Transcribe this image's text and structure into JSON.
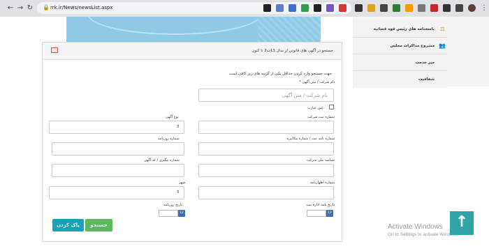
{
  "browser": {
    "url": "rrk.ir/News/newsList.aspx"
  },
  "right_menu": {
    "items": [
      {
        "label": "پاسخنامه های رئیس قوه قضائیه"
      },
      {
        "label": "مشروح مذاکرات مجلس"
      },
      {
        "label": "میز خدمت"
      },
      {
        "label": "شفافیت"
      }
    ]
  },
  "panel": {
    "title": "جستجو در آگهی های قانونی از سال 13ت2 تا کنون",
    "hint": "جهت جستجو وارد کردن حداقل یکی از گزینه های زیر کافی است"
  },
  "form": {
    "company_name_label": "* نام شرکت / متن آگهی",
    "company_name_placeholder": "نام شرکت / متن آگهی",
    "exact_phrase_label": "عین عبارت",
    "reg_number_label": "شماره ثبت شرکت",
    "ad_type_label": "نوع آگهی",
    "letter_number_label": "شماره نامه ثبت / شماره مکانیزه",
    "newspaper_number_label": "شماره روزنامه",
    "national_id_label": "شناسه ملی شرکت",
    "tracking_label": "شماره پیگیری / کد آگهی",
    "declaration_label": "شماره اظهارنامه",
    "city_label": "شهر",
    "registry_date_label": "تاریخ نامه اداره ثبت",
    "newspaper_date_label": "تاریخ روزنامه",
    "calendar_text": "12",
    "search_button": "جستجو",
    "clear_button": "پاک کردن"
  },
  "watermark": {
    "title": "Activate Windows",
    "subtitle": "Go to Settings to activate Windows."
  },
  "colors": {
    "search_button": "#5cb85c",
    "clear_button": "#17a2b8",
    "scroll_top": "#2fa5a5"
  }
}
